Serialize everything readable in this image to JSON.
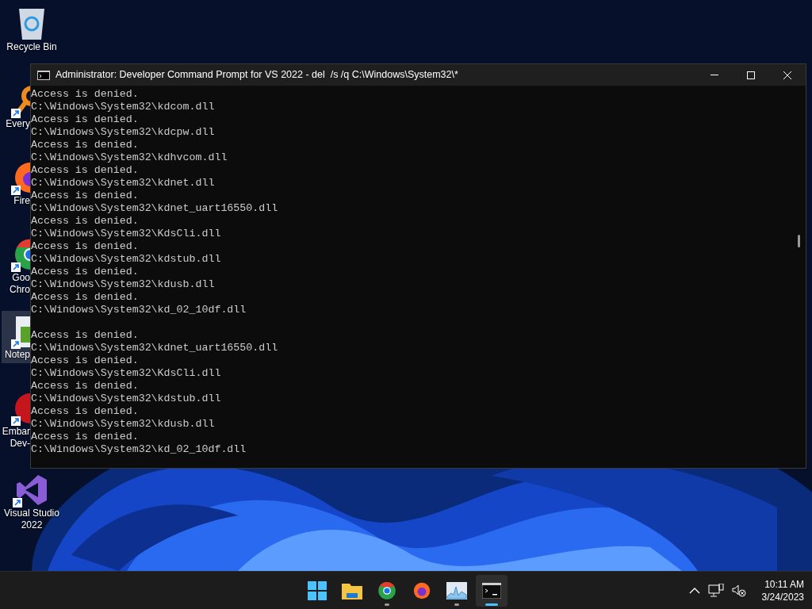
{
  "desktop_icons": [
    {
      "label": "Recycle Bin",
      "kind": "full",
      "shortcut": false,
      "selected": false
    },
    {
      "label": "Every",
      "kind": "partial",
      "shortcut": true,
      "selected": false
    },
    {
      "label": "Fire",
      "kind": "partial",
      "shortcut": true,
      "selected": false
    },
    {
      "label": "Goo\nChro",
      "kind": "partial",
      "shortcut": true,
      "selected": false
    },
    {
      "label": "Notep",
      "kind": "partial",
      "shortcut": true,
      "selected": true
    },
    {
      "label": "Embar\nDev-",
      "kind": "partial",
      "shortcut": true,
      "selected": false
    },
    {
      "label": "Visual Studio\n2022",
      "kind": "full",
      "shortcut": true,
      "selected": false
    }
  ],
  "window": {
    "title": "Administrator: Developer Command Prompt for VS 2022 - del  /s /q C:\\Windows\\System32\\*",
    "console_blocks": [
      [
        "Access is denied.",
        "C:\\Windows\\System32\\kdcom.dll",
        "Access is denied.",
        "C:\\Windows\\System32\\kdcpw.dll",
        "Access is denied.",
        "C:\\Windows\\System32\\kdhvcom.dll",
        "Access is denied.",
        "C:\\Windows\\System32\\kdnet.dll",
        "Access is denied.",
        "C:\\Windows\\System32\\kdnet_uart16550.dll",
        "Access is denied.",
        "C:\\Windows\\System32\\KdsCli.dll",
        "Access is denied.",
        "C:\\Windows\\System32\\kdstub.dll",
        "Access is denied.",
        "C:\\Windows\\System32\\kdusb.dll",
        "Access is denied.",
        "C:\\Windows\\System32\\kd_02_10df.dll"
      ],
      [
        "Access is denied.",
        "C:\\Windows\\System32\\kdnet_uart16550.dll",
        "Access is denied.",
        "C:\\Windows\\System32\\KdsCli.dll",
        "Access is denied.",
        "C:\\Windows\\System32\\kdstub.dll",
        "Access is denied.",
        "C:\\Windows\\System32\\kdusb.dll",
        "Access is denied.",
        "C:\\Windows\\System32\\kd_02_10df.dll"
      ]
    ]
  },
  "taskbar": {
    "apps": [
      {
        "running": false,
        "selected": false
      },
      {
        "running": false,
        "selected": false
      },
      {
        "running": true,
        "selected": false
      },
      {
        "running": false,
        "selected": false
      },
      {
        "running": true,
        "selected": false
      },
      {
        "running": true,
        "selected": true
      }
    ],
    "clock": {
      "time": "10:11 AM",
      "date": "3/24/2023"
    }
  }
}
